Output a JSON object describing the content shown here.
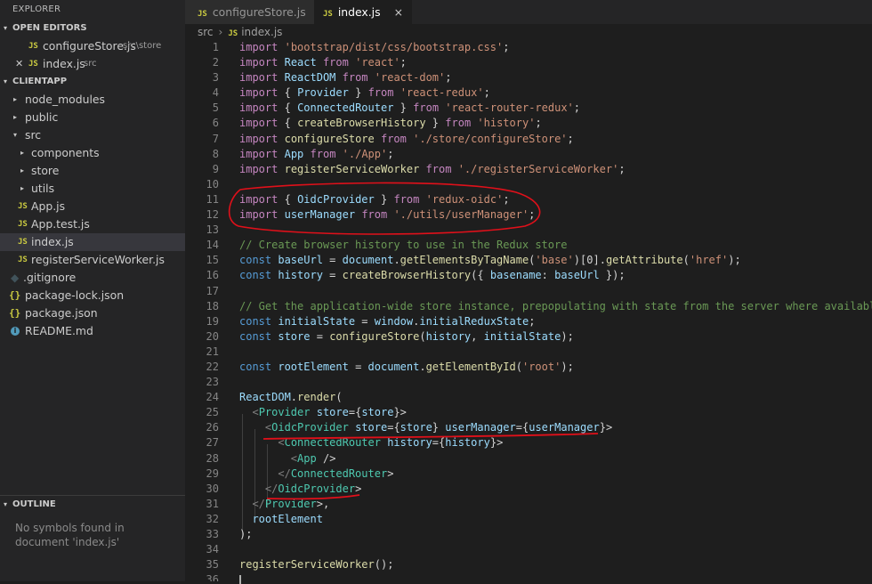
{
  "explorer": {
    "title": "EXPLORER",
    "open_editors_header": "OPEN EDITORS",
    "open_editors": [
      {
        "name": "configureStore.js",
        "path": "src\\store",
        "icon": "js-icon"
      },
      {
        "name": "index.js",
        "path": "src",
        "icon": "js-icon",
        "active": true
      }
    ],
    "project_header": "CLIENTAPP",
    "tree": [
      {
        "name": "node_modules",
        "type": "folder",
        "collapsed": true
      },
      {
        "name": "public",
        "type": "folder",
        "collapsed": true
      },
      {
        "name": "src",
        "type": "folder",
        "collapsed": false
      },
      {
        "name": "components",
        "type": "folder",
        "collapsed": true
      },
      {
        "name": "store",
        "type": "folder",
        "collapsed": true
      },
      {
        "name": "utils",
        "type": "folder",
        "collapsed": true
      },
      {
        "name": "App.js",
        "type": "js"
      },
      {
        "name": "App.test.js",
        "type": "js"
      },
      {
        "name": "index.js",
        "type": "js",
        "selected": true
      },
      {
        "name": "registerServiceWorker.js",
        "type": "js"
      },
      {
        "name": ".gitignore",
        "type": "git"
      },
      {
        "name": "package-lock.json",
        "type": "json"
      },
      {
        "name": "package.json",
        "type": "json"
      },
      {
        "name": "README.md",
        "type": "info"
      }
    ],
    "outline_header": "OUTLINE",
    "outline_message": "No symbols found in document 'index.js'"
  },
  "tabs": [
    {
      "label": "configureStore.js",
      "icon": "js-icon",
      "active": false
    },
    {
      "label": "index.js",
      "icon": "js-icon",
      "active": true,
      "close": "×"
    }
  ],
  "breadcrumb": {
    "folder": "src",
    "separator": "›",
    "file": "index.js",
    "icon_label": "JS"
  },
  "icon_labels": {
    "js": "JS",
    "json": "{}",
    "git": "◆",
    "info": "i",
    "close": "✕"
  },
  "editor": {
    "line_numbers": [
      "1",
      "2",
      "3",
      "4",
      "5",
      "6",
      "7",
      "8",
      "9",
      "10",
      "11",
      "12",
      "13",
      "14",
      "15",
      "16",
      "17",
      "18",
      "19",
      "20",
      "21",
      "22",
      "23",
      "24",
      "25",
      "26",
      "27",
      "28",
      "29",
      "30",
      "31",
      "32",
      "33",
      "34",
      "35",
      "36"
    ],
    "lines": [
      "import 'bootstrap/dist/css/bootstrap.css';",
      "import React from 'react';",
      "import ReactDOM from 'react-dom';",
      "import { Provider } from 'react-redux';",
      "import { ConnectedRouter } from 'react-router-redux';",
      "import { createBrowserHistory } from 'history';",
      "import configureStore from './store/configureStore';",
      "import App from './App';",
      "import registerServiceWorker from './registerServiceWorker';",
      "",
      "import { OidcProvider } from 'redux-oidc';",
      "import userManager from './utils/userManager';",
      "",
      "// Create browser history to use in the Redux store",
      "const baseUrl = document.getElementsByTagName('base')[0].getAttribute('href');",
      "const history = createBrowserHistory({ basename: baseUrl });",
      "",
      "// Get the application-wide store instance, prepopulating with state from the server where available.",
      "const initialState = window.initialReduxState;",
      "const store = configureStore(history, initialState);",
      "",
      "const rootElement = document.getElementById('root');",
      "",
      "ReactDOM.render(",
      "  <Provider store={store}>",
      "    <OidcProvider store={store} userManager={userManager}>",
      "      <ConnectedRouter history={history}>",
      "        <App />",
      "      </ConnectedRouter>",
      "    </OidcProvider>",
      "  </Provider>,",
      "  rootElement",
      ");",
      "",
      "registerServiceWorker();",
      ""
    ]
  },
  "colors": {
    "keyword": "#569cd6",
    "control_keyword": "#c586c0",
    "string": "#ce9178",
    "comment": "#6a9955",
    "variable": "#9cdcfe",
    "function": "#dcdcaa",
    "tag": "#4ec9b0",
    "annotation": "#e0101a"
  }
}
